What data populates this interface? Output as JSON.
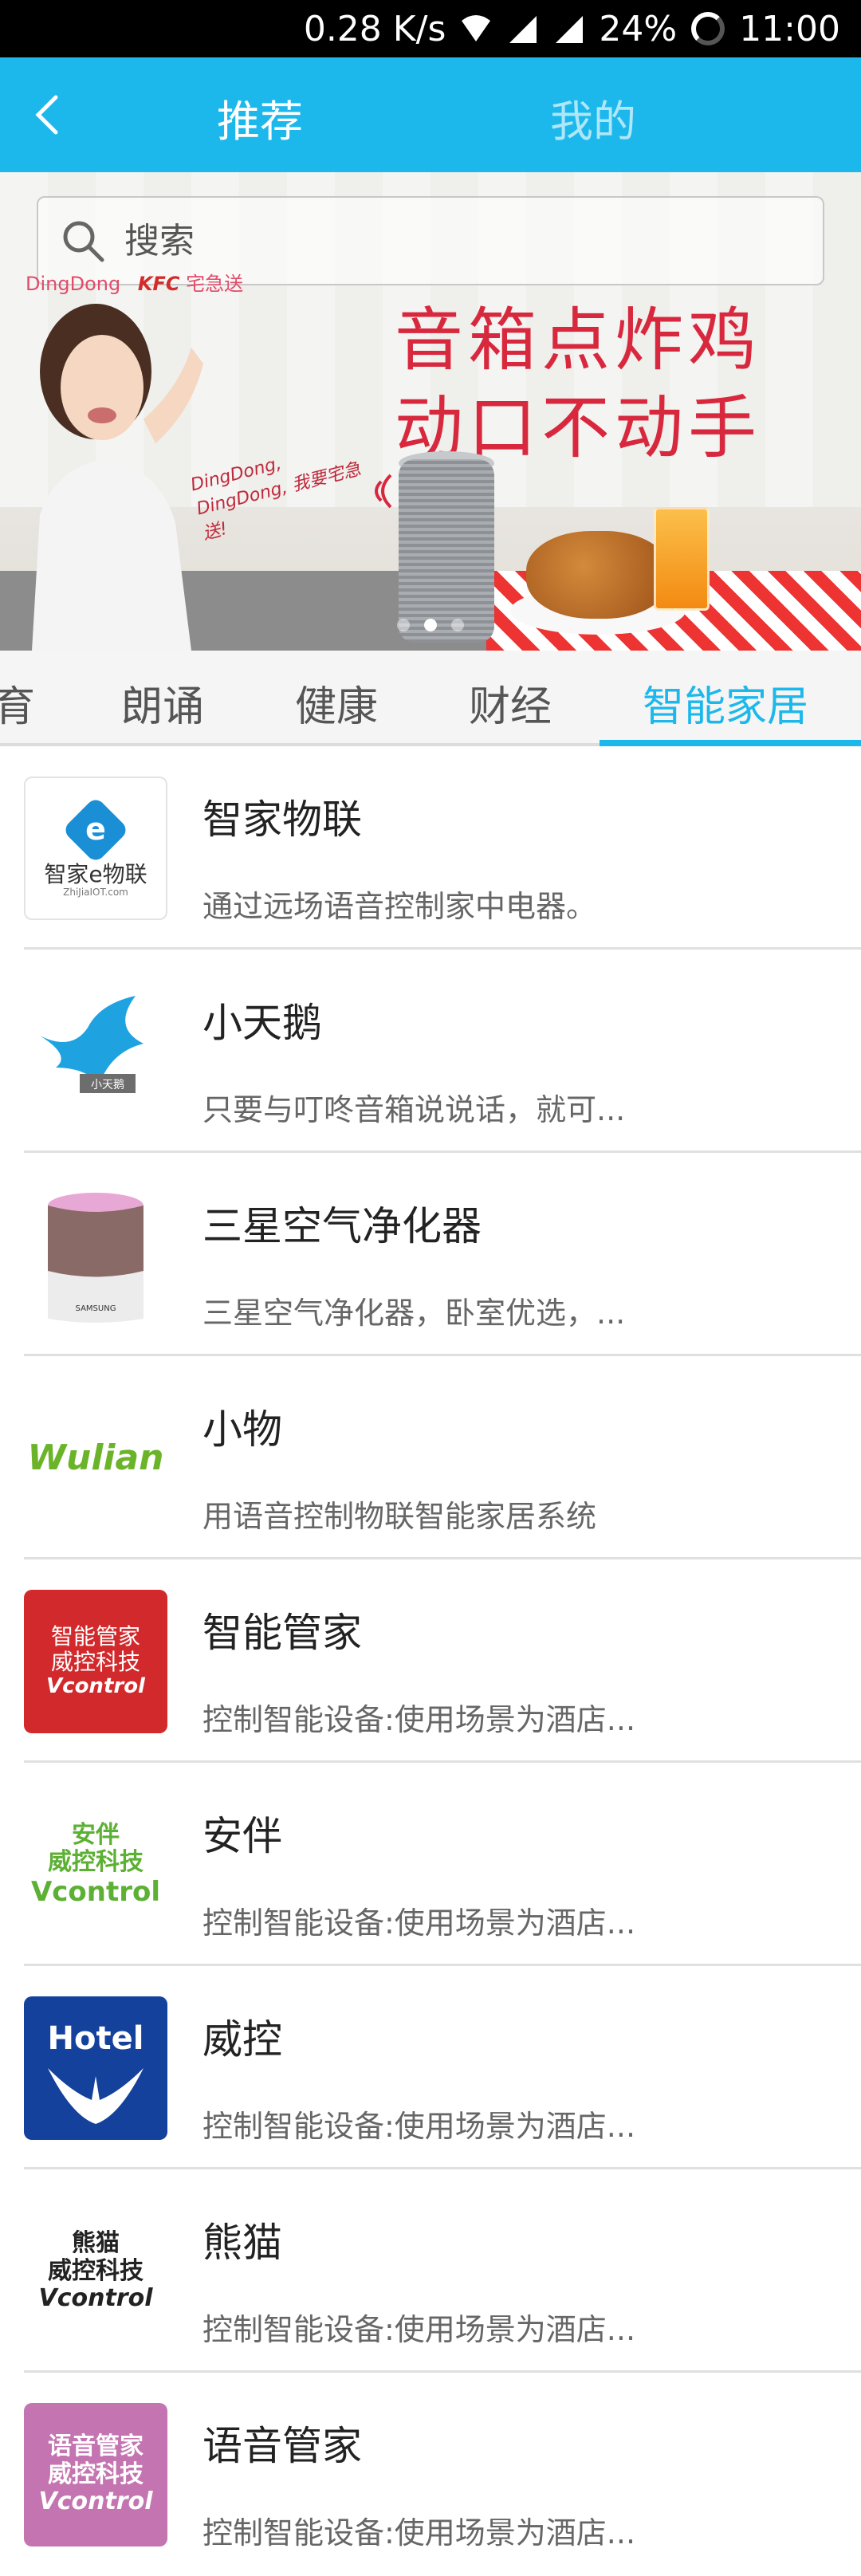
{
  "status_bar": {
    "speed": "0.28 K/s",
    "battery": "24%",
    "time": "11:00"
  },
  "header": {
    "tab_recommend": "推荐",
    "tab_mine": "我的"
  },
  "search": {
    "placeholder": "搜索"
  },
  "banner": {
    "logo_left": "DingDong",
    "logo_right": "KFC",
    "logo_right_sub": "宅急送",
    "slogan_line1": "音箱点炸鸡",
    "slogan_line2": "动口不动手",
    "speech": "DingDong, DingDong, 我要宅急送!",
    "slides": 3,
    "active_slide": 2
  },
  "categories": {
    "items": [
      "育",
      "朗诵",
      "健康",
      "财经",
      "智能家居"
    ],
    "active_index": 4
  },
  "list": [
    {
      "title": "智家物联",
      "desc": "通过远场语音控制家中电器。",
      "icon_text": "智家e物联",
      "icon_sub": "ZhiJiaIOT.com"
    },
    {
      "title": "小天鹅",
      "desc": "只要与叮咚音箱说说话，就可...",
      "icon_text": "小天鹅"
    },
    {
      "title": "三星空气净化器",
      "desc": "三星空气净化器，卧室优选，...",
      "icon_text": "SAMSUNG"
    },
    {
      "title": "小物",
      "desc": "用语音控制物联智能家居系统",
      "icon_text": "Wulian"
    },
    {
      "title": "智能管家",
      "desc": "控制智能设备:使用场景为酒店...",
      "icon_line1": "智能管家",
      "icon_line2": "威控科技",
      "icon_line3": "Vcontrol"
    },
    {
      "title": "安伴",
      "desc": "控制智能设备:使用场景为酒店...",
      "icon_line1": "安伴",
      "icon_line2": "威控科技",
      "icon_line3": "Vcontrol"
    },
    {
      "title": "威控",
      "desc": "控制智能设备:使用场景为酒店...",
      "icon_text": "Hotel"
    },
    {
      "title": "熊猫",
      "desc": "控制智能设备:使用场景为酒店...",
      "icon_line1": "熊猫",
      "icon_line2": "威控科技",
      "icon_line3": "Vcontrol"
    },
    {
      "title": "语音管家",
      "desc": "控制智能设备:使用场景为酒店...",
      "icon_line1": "语音管家",
      "icon_line2": "威控科技",
      "icon_line3": "Vcontrol"
    }
  ],
  "colors": {
    "accent": "#1cb8ec",
    "banner_red": "#d8283e"
  }
}
